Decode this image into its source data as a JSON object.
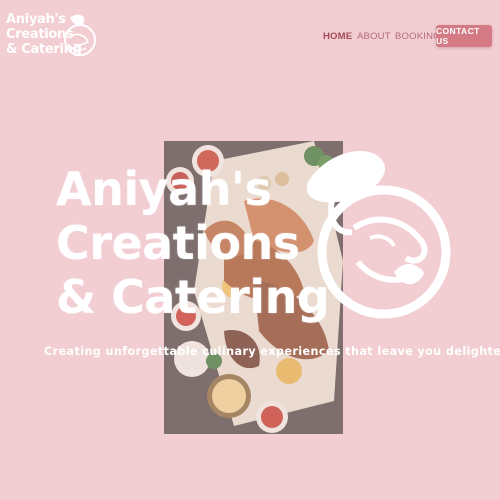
{
  "brand": {
    "logo_line1": "Aniyah's",
    "logo_line2": "Creations",
    "logo_line3": "& Catering",
    "logo_icon": "chef-globe-icon"
  },
  "nav": {
    "items": [
      {
        "label": "HOME",
        "active": true
      },
      {
        "label": "ABOUT",
        "active": false
      },
      {
        "label": "BOOKING",
        "active": false
      }
    ],
    "contact_label": "CONTACT US"
  },
  "hero": {
    "title_line1": "Aniyah's",
    "title_line2": "Creations",
    "title_line3": "& Catering",
    "tagline": "Creating unforgettable culinary experiences that leave you delighted.",
    "image": "catering-platter-photo",
    "mark_icon": "chef-globe-icon"
  },
  "colors": {
    "background": "#f2cdd2",
    "nav_text": "#b46b78",
    "nav_active": "#a34a5a",
    "button_bg": "#d47a84",
    "text": "#ffffff"
  }
}
